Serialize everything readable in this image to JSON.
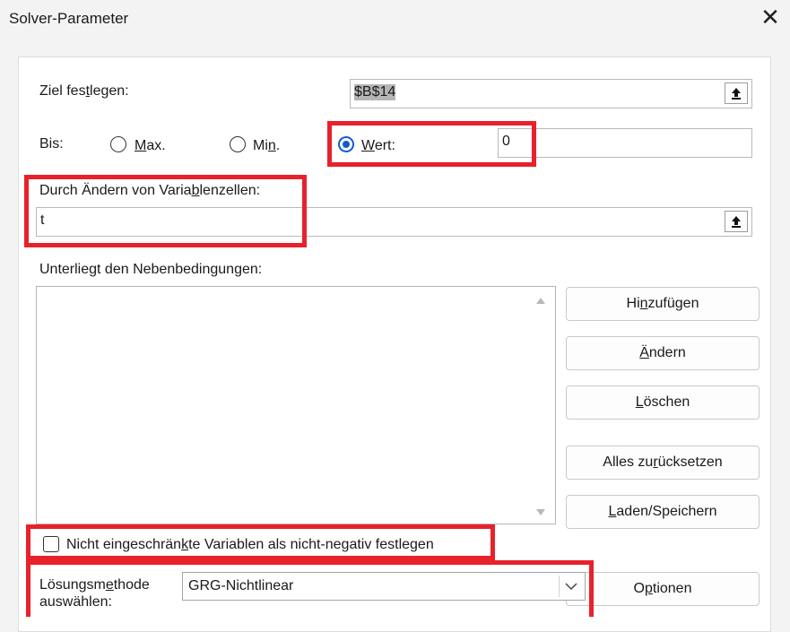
{
  "window": {
    "title": "Solver-Parameter",
    "close_icon": "close-icon"
  },
  "target": {
    "label": "Ziel festlegen:",
    "value": "$B$14"
  },
  "to": {
    "label": "Bis:",
    "max_label": "Max.",
    "min_label": "Min.",
    "value_label": "Wert:",
    "value": "0",
    "selected": "value"
  },
  "variables": {
    "label": "Durch Ändern von Variablenzellen:",
    "value": "t"
  },
  "constraints": {
    "label": "Unterliegt den Nebenbedingungen:",
    "items": []
  },
  "buttons": {
    "add": "Hinzufügen",
    "change": "Ändern",
    "delete": "Löschen",
    "reset_all": "Alles zurücksetzen",
    "load_save": "Laden/Speichern",
    "options": "Optionen"
  },
  "nonneg": {
    "label": "Nicht eingeschränkte Variablen als nicht-negativ festlegen",
    "checked": false
  },
  "method": {
    "label_line1": "Lösungsmethode",
    "label_line2": "auswählen:",
    "value": "GRG-Nichtlinear"
  },
  "colors": {
    "highlight": "#e8212b",
    "radio_selected": "#0f5ccf"
  }
}
